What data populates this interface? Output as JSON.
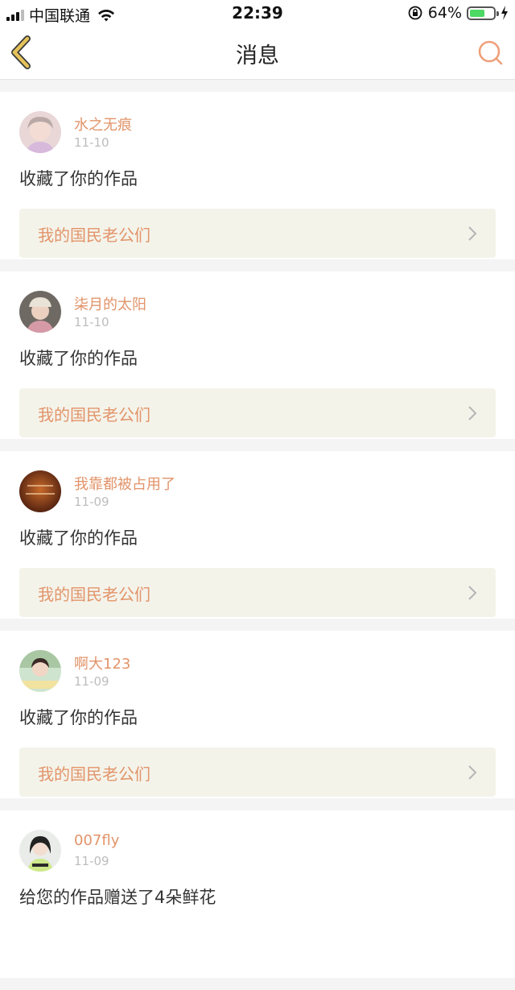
{
  "status_bar": {
    "carrier": "中国联通",
    "time": "22:39",
    "battery": "64%",
    "battery_level": 0.64
  },
  "nav": {
    "title": "消息",
    "back_icon": "back-chevron-icon",
    "search_icon": "search-icon"
  },
  "colors": {
    "accent": "#e2946a",
    "back_icon": "#c9a43a",
    "work_bg": "#f4f3ea",
    "battery": "#4cd964"
  },
  "messages": [
    {
      "user": "水之无痕",
      "date": "11-10",
      "action": "收藏了你的作品",
      "work": "我的国民老公们"
    },
    {
      "user": "柒月的太阳",
      "date": "11-10",
      "action": "收藏了你的作品",
      "work": "我的国民老公们"
    },
    {
      "user": "我靠都被占用了",
      "date": "11-09",
      "action": "收藏了你的作品",
      "work": "我的国民老公们"
    },
    {
      "user": "啊大123",
      "date": "11-09",
      "action": "收藏了你的作品",
      "work": "我的国民老公们"
    },
    {
      "user": "007fly",
      "date": "11-09",
      "action": "给您的作品赠送了4朵鲜花",
      "work": ""
    }
  ]
}
